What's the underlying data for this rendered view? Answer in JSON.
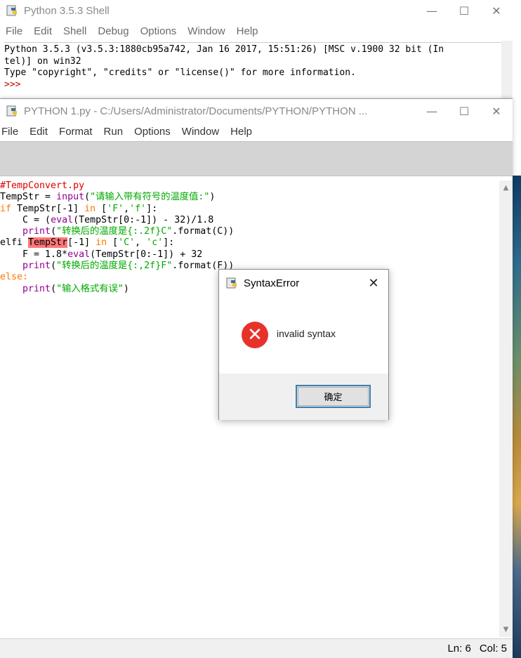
{
  "shell": {
    "title": "Python 3.5.3 Shell",
    "menu": [
      "File",
      "Edit",
      "Shell",
      "Debug",
      "Options",
      "Window",
      "Help"
    ],
    "banner_line1": "Python 3.5.3 (v3.5.3:1880cb95a742, Jan 16 2017, 15:51:26) [MSC v.1900 32 bit (In",
    "banner_line2": "tel)] on win32",
    "banner_line3": "Type \"copyright\", \"credits\" or \"license()\" for more information.",
    "prompt": ">>>"
  },
  "editor": {
    "title": "PYTHON 1.py - C:/Users/Administrator/Documents/PYTHON/PYTHON ...",
    "menu": [
      "File",
      "Edit",
      "Format",
      "Run",
      "Options",
      "Window",
      "Help"
    ],
    "code": {
      "l1": "#TempConvert.py",
      "l2a": "TempStr = ",
      "l2b": "input",
      "l2c": "(",
      "l2d": "\"请输入带有符号的温度值:\"",
      "l2e": ")",
      "l3a": "if",
      "l3b": " TempStr[-1] ",
      "l3c": "in",
      "l3d": " [",
      "l3e": "'F'",
      "l3f": ",",
      "l3g": "'f'",
      "l3h": "]:",
      "l4a": "    C = (",
      "l4b": "eval",
      "l4c": "(TempStr[0:-1]) - 32)/1.8",
      "l5a": "    ",
      "l5b": "print",
      "l5c": "(",
      "l5d": "\"转换后的温度是{:.2f}C\"",
      "l5e": ".format(C))",
      "l6a": "elfi ",
      "l6b": "TempStr",
      "l6c": "[-1] ",
      "l6d": "in",
      "l6e": " [",
      "l6f": "'C'",
      "l6g": ", ",
      "l6h": "'c'",
      "l6i": "]:",
      "l7a": "    F = 1.8*",
      "l7b": "eval",
      "l7c": "(TempStr[0:-1]) + 32",
      "l8a": "    ",
      "l8b": "print",
      "l8c": "(",
      "l8d": "\"转换后的温度是{:,2f}F\"",
      "l8e": ".format(F))",
      "l9": "else:",
      "l10a": "    ",
      "l10b": "print",
      "l10c": "(",
      "l10d": "\"输入格式有误\"",
      "l10e": ")"
    },
    "status": {
      "line": "Ln: 6",
      "col": "Col: 5"
    }
  },
  "dialog": {
    "title": "SyntaxError",
    "message": "invalid syntax",
    "ok_label": "确定",
    "close_glyph": "✕",
    "error_glyph": "✕"
  },
  "window_controls": {
    "minimize": "—",
    "maximize": "☐",
    "close": "✕"
  },
  "colors": {
    "keyword": "#ff7700",
    "comment": "#dd0000",
    "string": "#00aa00",
    "builtin": "#900090",
    "error_highlight": "#ff7777",
    "error_icon": "#e6322b"
  }
}
